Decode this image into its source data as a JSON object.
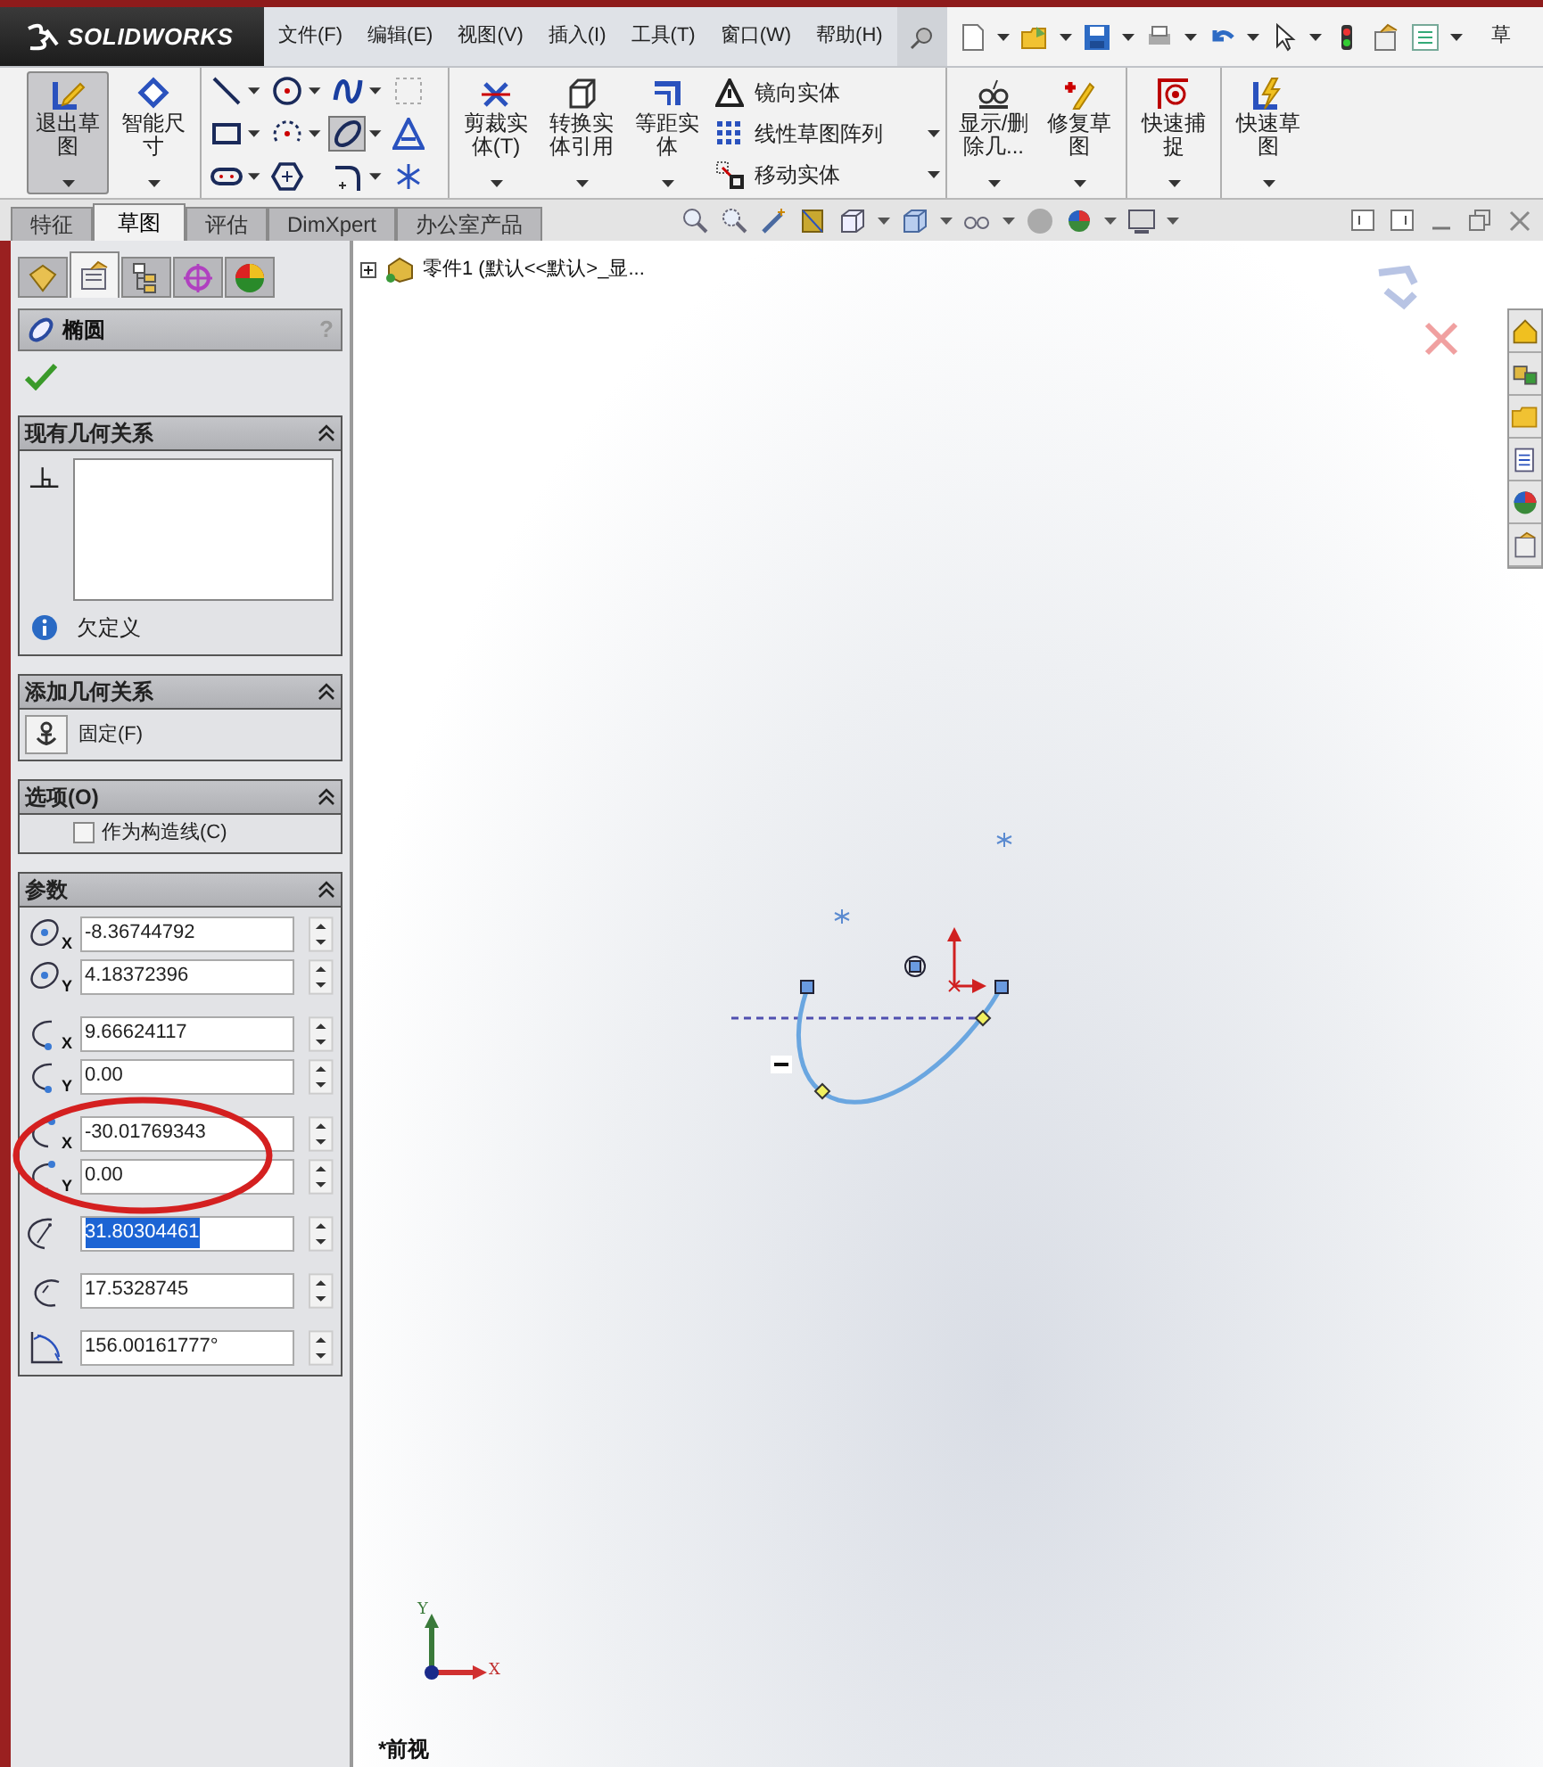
{
  "title_bar": {
    "logo": "SOLIDWORKS",
    "menu": [
      "文件(F)",
      "编辑(E)",
      "视图(V)",
      "插入(I)",
      "工具(T)",
      "窗口(W)",
      "帮助(H)"
    ],
    "cut_text": "草"
  },
  "ribbon": [
    [
      {
        "kind": "large",
        "label": "退出草图",
        "selected": true
      },
      {
        "kind": "large",
        "label": "智能尺寸",
        "selected": false
      }
    ],
    [
      {
        "kind": "tools",
        "tools": [
          {
            "dropdown": true,
            "selected": false
          },
          {
            "dropdown": true,
            "selected": false
          },
          {
            "dropdown": true,
            "selected": false
          },
          {
            "dropdown": false,
            "selected": false
          },
          {
            "dropdown": true,
            "selected": false
          },
          {
            "dropdown": true,
            "selected": false
          },
          {
            "dropdown": true,
            "selected": true
          },
          {
            "dropdown": false,
            "selected": false
          },
          {
            "dropdown": true,
            "selected": false
          },
          {
            "dropdown": false,
            "selected": false
          },
          {
            "dropdown": true,
            "selected": false
          },
          {
            "dropdown": false,
            "selected": false
          }
        ]
      }
    ],
    [
      {
        "kind": "large",
        "label": "剪裁实体(T)",
        "selected": false
      },
      {
        "kind": "large",
        "label": "转换实体引用",
        "selected": false
      },
      {
        "kind": "large",
        "label": "等距实体",
        "selected": false
      },
      {
        "kind": "list",
        "items": [
          {
            "label": "镜向实体"
          },
          {
            "label": "线性草图阵列"
          },
          {
            "label": "移动实体"
          }
        ]
      }
    ],
    [
      {
        "kind": "large",
        "label": "显示/删除几...",
        "selected": false
      },
      {
        "kind": "large",
        "label": "修复草图",
        "selected": false
      }
    ],
    [
      {
        "kind": "large",
        "label": "快速捕捉",
        "selected": false
      }
    ],
    [
      {
        "kind": "large",
        "label": "快速草图",
        "selected": false
      }
    ]
  ],
  "command_tabs": [
    {
      "label": "特征",
      "selected": false
    },
    {
      "label": "草图",
      "selected": true
    },
    {
      "label": "评估",
      "selected": false
    },
    {
      "label": "DimXpert",
      "selected": false
    },
    {
      "label": "办公室产品",
      "selected": false
    }
  ],
  "property_manager": {
    "tabs": [
      {
        "kind": "feature",
        "selected": false
      },
      {
        "kind": "property",
        "selected": true
      },
      {
        "kind": "config",
        "selected": false
      },
      {
        "kind": "dimxpert",
        "selected": false
      },
      {
        "kind": "display",
        "selected": false
      }
    ],
    "title": "椭圆",
    "help": "?",
    "existing_relations": {
      "title": "现有几何关系",
      "expanded": true,
      "status": "欠定义"
    },
    "add_relations": {
      "title": "添加几何关系",
      "expanded": true,
      "items": [
        "固定(F)"
      ]
    },
    "options": {
      "title": "选项(O)",
      "expanded": true,
      "construction": {
        "label": "作为构造线(C)",
        "checked": false
      }
    },
    "parameters": {
      "title": "参数",
      "expanded": true,
      "groups": [
        [
          {
            "kind": "center",
            "axis": "X",
            "value": "-8.36744792",
            "highlighted": false
          },
          {
            "kind": "center",
            "axis": "Y",
            "value": "4.18372396",
            "highlighted": false
          }
        ],
        [
          {
            "kind": "start",
            "axis": "X",
            "value": "9.66624117",
            "highlighted": false
          },
          {
            "kind": "start",
            "axis": "Y",
            "value": "0.00",
            "highlighted": false
          }
        ],
        [
          {
            "kind": "end",
            "axis": "X",
            "value": "-30.01769343",
            "highlighted": false
          },
          {
            "kind": "end",
            "axis": "Y",
            "value": "0.00",
            "highlighted": false
          }
        ],
        [
          {
            "kind": "major",
            "value": "31.80304461",
            "highlighted": true
          }
        ],
        [
          {
            "kind": "minor",
            "value": "17.5328745",
            "highlighted": false
          }
        ],
        [
          {
            "kind": "angle",
            "value": "156.00161777°",
            "highlighted": false
          }
        ]
      ]
    }
  },
  "feature_tree": {
    "root": "零件1 (默认<<默认>_显...",
    "expanded": false
  },
  "view": {
    "triad": {
      "y": "Y",
      "x": "X"
    },
    "orientation": "*前视"
  }
}
